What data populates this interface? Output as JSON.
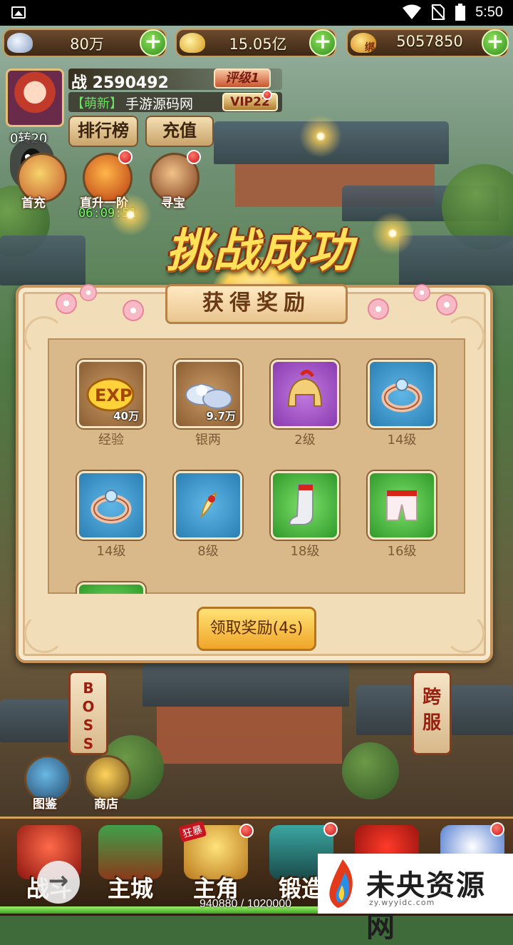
{
  "status_bar": {
    "time": "5:50"
  },
  "currencies": [
    {
      "name": "silver",
      "value": "80万"
    },
    {
      "name": "gold-ingot",
      "value": "15.05亿"
    },
    {
      "name": "bound-gold",
      "icon_text": "绑",
      "value": "5057850"
    }
  ],
  "player": {
    "power_label": "战 2590492",
    "rating": "评级1",
    "tag": "【萌新】",
    "name": "手游源码网",
    "vip": "VIP22",
    "level": "0转20"
  },
  "top_buttons": {
    "ranking": "排行榜",
    "recharge": "充值"
  },
  "feature_icons": [
    {
      "label": "首充"
    },
    {
      "label": "直升一阶",
      "timer": "06:09:51"
    },
    {
      "label": "寻宝"
    }
  ],
  "banner": {
    "title": "挑战成功"
  },
  "dialog": {
    "header": "获得奖励",
    "rewards": [
      {
        "label": "经验",
        "count": "40万",
        "rarity": "brown",
        "icon": "exp-icon"
      },
      {
        "label": "银两",
        "count": "9.7万",
        "rarity": "brown",
        "icon": "silver-ingot-icon"
      },
      {
        "label": "2级",
        "count": "",
        "rarity": "purple",
        "icon": "helmet-icon"
      },
      {
        "label": "14级",
        "count": "",
        "rarity": "blue",
        "icon": "ring-icon"
      },
      {
        "label": "14级",
        "count": "",
        "rarity": "blue",
        "icon": "ring-icon"
      },
      {
        "label": "8级",
        "count": "",
        "rarity": "blue",
        "icon": "amulet-icon"
      },
      {
        "label": "18级",
        "count": "",
        "rarity": "green",
        "icon": "boots-icon"
      },
      {
        "label": "16级",
        "count": "",
        "rarity": "green",
        "icon": "pants-icon"
      },
      {
        "label": "",
        "count": "",
        "rarity": "green",
        "icon": "item-icon"
      }
    ],
    "claim_button": "领取奖励(4s)"
  },
  "side_buttons": {
    "boss": "BOSS",
    "cross_server": "跨服"
  },
  "map_buttons": {
    "atlas": "图鉴",
    "shop": "商店"
  },
  "bottom_nav": [
    {
      "label": "战斗",
      "icon": "battle-icon"
    },
    {
      "label": "主城",
      "icon": "city-icon"
    },
    {
      "label": "主角",
      "icon": "hero-icon",
      "badge": "狂暴"
    },
    {
      "label": "锻造",
      "icon": "forge-icon"
    },
    {
      "label": "",
      "icon": "bag-icon"
    },
    {
      "label": "",
      "icon": "more-icon"
    }
  ],
  "exp": {
    "text": "940880 / 1020000",
    "progress": 0.92
  },
  "watermark": {
    "text": "未央资源网",
    "sub": "zy.wyyidc.com"
  },
  "colors": {
    "accent": "#ffe25a",
    "panel": "#f1ddb8",
    "claim": "#f0a529"
  }
}
